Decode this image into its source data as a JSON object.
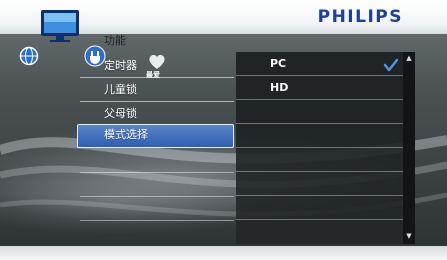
{
  "header": {
    "brand": "PHILIPS"
  },
  "icons": {
    "tv": "tv-icon",
    "globe": "globe-icon",
    "plug": "plug-icon",
    "favorites": "favorites-icon",
    "favorites_label": "最爱"
  },
  "menu": {
    "title": "功能",
    "items": [
      {
        "label": "定时器"
      },
      {
        "label": "儿童锁"
      },
      {
        "label": "父母锁"
      },
      {
        "label": "模式选择",
        "selected": true
      }
    ]
  },
  "options": {
    "items": [
      {
        "label": "PC",
        "checked": true
      },
      {
        "label": "HD",
        "checked": false
      }
    ]
  },
  "colors": {
    "brand": "#1f3f9a",
    "selection": "#2f5fb0",
    "check": "#5b8fe0"
  }
}
